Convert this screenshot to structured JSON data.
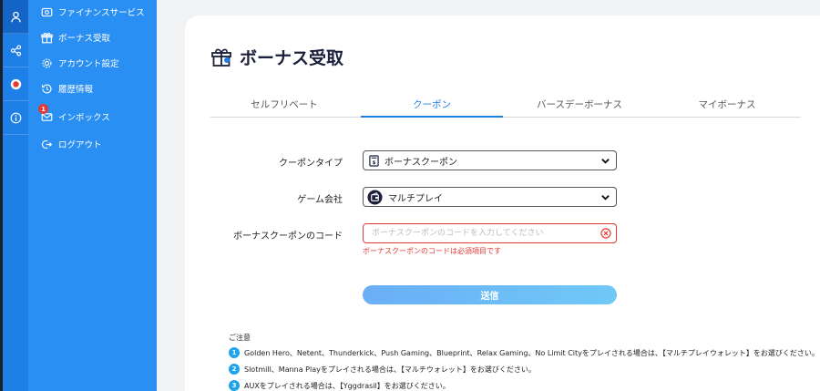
{
  "rail": {
    "items": [
      {
        "icon": "user-icon"
      },
      {
        "icon": "share-icon"
      },
      {
        "icon": "record-icon"
      },
      {
        "icon": "info-icon"
      }
    ]
  },
  "sidebar": {
    "items": [
      {
        "label": "ファイナンスサービス",
        "icon": "finance-icon"
      },
      {
        "label": "ボーナス受取",
        "icon": "gift-icon"
      },
      {
        "label": "アカウント設定",
        "icon": "gear-icon"
      },
      {
        "label": "履歴情報",
        "icon": "history-icon"
      },
      {
        "label": "インボックス",
        "icon": "mail-icon",
        "badge": "1"
      },
      {
        "label": "ログアウト",
        "icon": "logout-icon"
      }
    ]
  },
  "page": {
    "title": "ボーナス受取",
    "title_icon": "gift-icon"
  },
  "tabs": [
    {
      "label": "セルフリベート",
      "active": false
    },
    {
      "label": "クーポン",
      "active": true
    },
    {
      "label": "バースデーボーナス",
      "active": false
    },
    {
      "label": "マイボーナス",
      "active": false
    }
  ],
  "form": {
    "coupon_type_label": "クーポンタイプ",
    "coupon_type_value": "ボーナスクーポン",
    "game_company_label": "ゲーム会社",
    "game_company_value": "マルチプレイ",
    "code_label": "ボーナスクーポンのコード",
    "code_placeholder": "ボーナスクーポンのコードを入力してください",
    "code_error": "ボーナスクーポンのコードは必須項目です",
    "submit_label": "送信"
  },
  "notes": {
    "title": "ご注意",
    "items": [
      {
        "num": "1",
        "text": "Golden Hero、Netent、Thunderkick、Push Gaming、Blueprint、Relax Gaming、No Limit Cityをプレイされる場合は、【マルチプレイウォレット】をお選びください。"
      },
      {
        "num": "2",
        "text": "Slotmill、Manna Playをプレイされる場合は、【マルチウォレット】をお選びください。"
      },
      {
        "num": "3",
        "text": "AUXをプレイされる場合は、【Yggdrasil】をお選びください。"
      }
    ]
  },
  "colors": {
    "rail": "#1e7fe6",
    "sidebar": "#2a8ff2",
    "accent": "#1e7fe6",
    "error": "#e53935",
    "badge": "#e53935"
  }
}
